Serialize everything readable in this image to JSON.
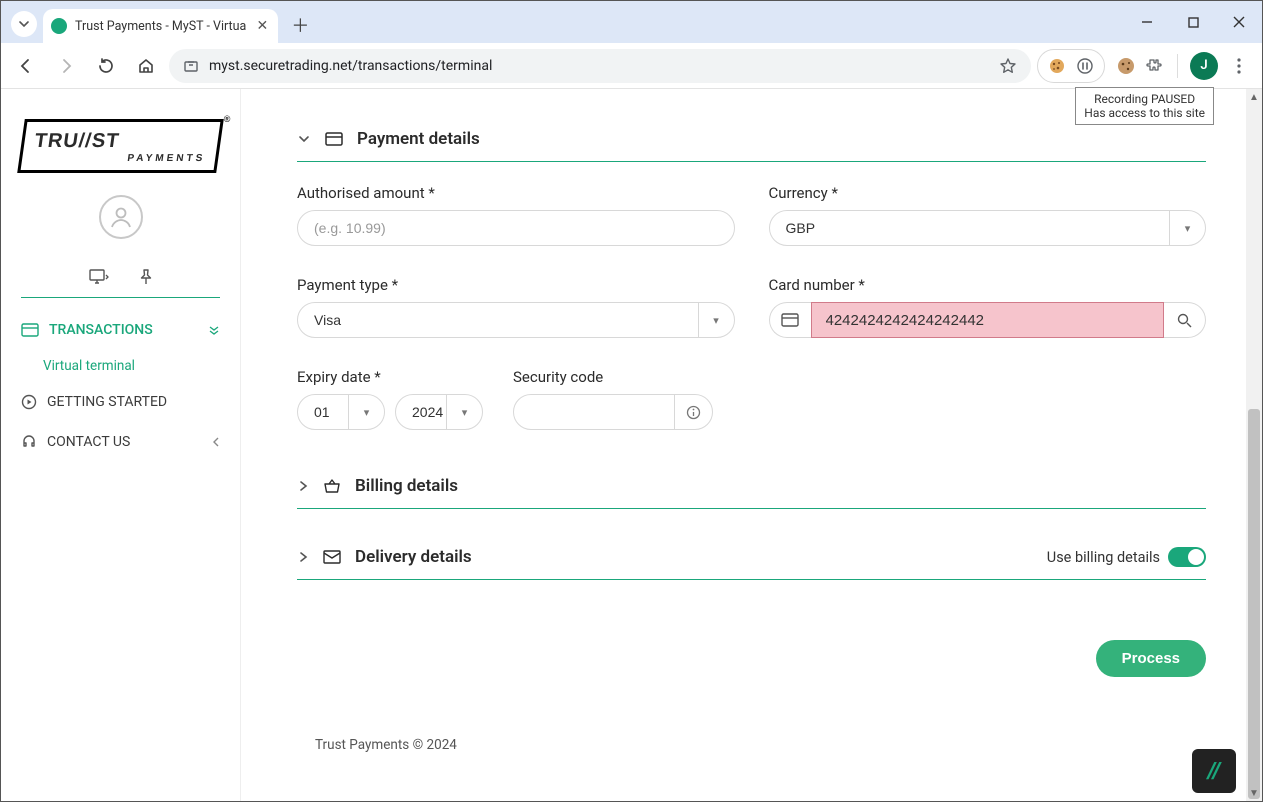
{
  "browser": {
    "tab_title": "Trust Payments - MyST - Virtua",
    "url": "myst.securetrading.net/transactions/terminal",
    "profile_letter": "J",
    "tooltip_line1": "Recording PAUSED",
    "tooltip_line2": "Has access to this site"
  },
  "sidebar": {
    "logo_top": "TRU//ST",
    "logo_bottom": "PAYMENTS",
    "nav": {
      "transactions": "TRANSACTIONS",
      "virtual_terminal": "Virtual terminal",
      "getting_started": "GETTING STARTED",
      "contact_us": "CONTACT US"
    }
  },
  "sections": {
    "payment_details": "Payment details",
    "billing_details": "Billing details",
    "delivery_details": "Delivery details",
    "use_billing": "Use billing details"
  },
  "fields": {
    "amount_label": "Authorised amount *",
    "amount_placeholder": "(e.g. 10.99)",
    "amount_value": "",
    "currency_label": "Currency *",
    "currency_value": "GBP",
    "payment_type_label": "Payment type *",
    "payment_type_value": "Visa",
    "card_number_label": "Card number *",
    "card_number_value": "4242424242424242442",
    "expiry_label": "Expiry date *",
    "expiry_month": "01",
    "expiry_year": "2024",
    "security_label": "Security code",
    "security_value": ""
  },
  "buttons": {
    "process": "Process"
  },
  "footer": "Trust Payments © 2024",
  "chat_glyph": "//"
}
